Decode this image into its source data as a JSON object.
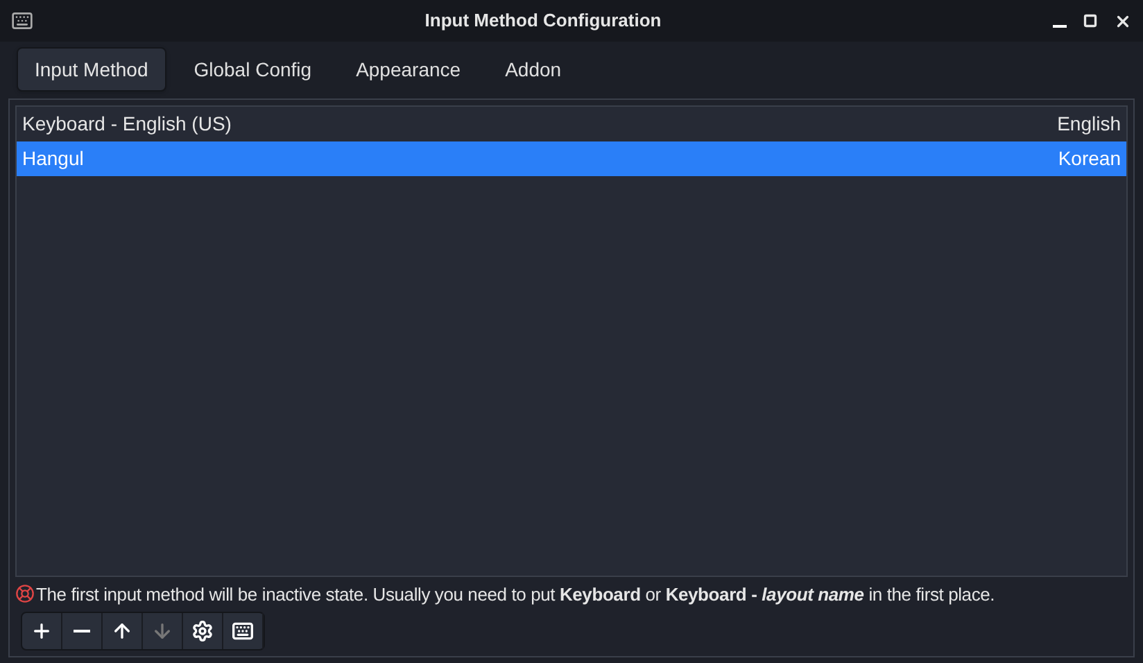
{
  "window": {
    "title": "Input Method Configuration"
  },
  "tabs": [
    {
      "label": "Input Method",
      "selected": true
    },
    {
      "label": "Global Config",
      "selected": false
    },
    {
      "label": "Appearance",
      "selected": false
    },
    {
      "label": "Addon",
      "selected": false
    }
  ],
  "input_methods": [
    {
      "name": "Keyboard - English (US)",
      "language": "English",
      "selected": false
    },
    {
      "name": "Hangul",
      "language": "Korean",
      "selected": true
    }
  ],
  "note": "The first input method will be inactive state. Usually you need to put **Keyboard** or **Keyboard -** *layout name* in the first place.",
  "toolbar": [
    {
      "kind": "add",
      "disabled": false
    },
    {
      "kind": "remove",
      "disabled": false
    },
    {
      "kind": "up",
      "disabled": false
    },
    {
      "kind": "down",
      "disabled": true
    },
    {
      "kind": "configure",
      "disabled": false
    },
    {
      "kind": "keyboard",
      "disabled": false
    }
  ]
}
